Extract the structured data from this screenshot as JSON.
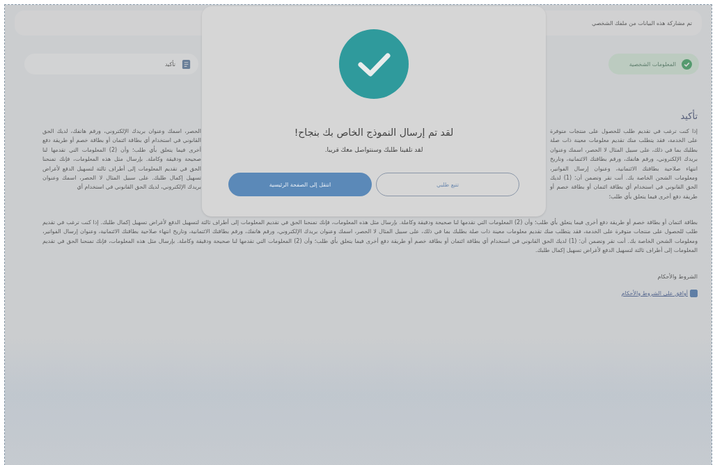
{
  "notice": {
    "text": "تم مشاركة هذه البيانات من ملفك الشخصي"
  },
  "steps": [
    {
      "label": "المعلومات الشخصية",
      "completed": true
    },
    {
      "label": "تأكيد",
      "completed": false
    }
  ],
  "section": {
    "title": "تأكيد",
    "paragraph_right": "إذا كنت ترغب في تقديم طلب للحصول على منتجات متوفرة على الخدمة، فقد يتطلب منك تقديم معلومات معينة ذات صلة بطلبك بما في ذلك، على سبيل المثال لا الحصر، اسمك وعنوان بريدك الإلكتروني، ورقم هاتفك، ورقم بطاقتك الائتمانية، وتاريخ انتهاء صلاحية بطاقتك الائتمانية، وعنوان إرسال الفواتير، ومعلومات الشحن الخاصة بك. أنت تقر وتضمن أن: (1) لديك الحق القانوني في استخدام أي بطاقة ائتمان أو بطاقة خصم أو طريقة دفع أخرى فيما يتعلق بأي طلب؛",
    "paragraph_left": "الحصر، اسمك وعنوان بريدك الإلكتروني، ورقم هاتفك، لديك الحق القانوني في استخدام أي بطاقة ائتمان أو بطاقة خصم أو طريقة دفع أخرى فيما يتعلق بأي طلب؛ وأن (2) المعلومات التي تقدمها لنا صحيحة ودقيقة وكاملة. بإرسال مثل هذه المعلومات، فإنك تمنحنا الحق في تقديم المعلومات إلى أطراف ثالثة لتسهيل الدفع لأغراض تسهيل إكمال طلبك. على سبيل المثال لا الحصر، اسمك وعنوان بريدك الإلكتروني، لديك الحق القانوني في استخدام أي",
    "paragraph_below": "بطاقة ائتمان أو بطاقة خصم أو طريقة دفع أخرى فيما يتعلق بأي طلب؛ وأن (2) المعلومات التي تقدمها لنا صحيحة ودقيقة وكاملة. بإرسال مثل هذه المعلومات، فإنك تمنحنا الحق في تقديم المعلومات إلى أطراف ثالثة لتسهيل الدفع لأغراض تسهيل إكمال طلبك. إذا كنت ترغب في تقديم طلب للحصول على منتجات متوفرة على الخدمة، فقد يتطلب منك تقديم معلومات معينة ذات صلة بطلبك بما في ذلك، على سبيل المثال لا الحصر، اسمك وعنوان بريدك الإلكتروني، ورقم هاتفك، ورقم بطاقتك الائتمانية، وتاريخ انتهاء صلاحية بطاقتك الائتمانية، وعنوان إرسال الفواتير، ومعلومات الشحن الخاصة بك. أنت تقر وتضمن أن: (1) لديك الحق القانوني في استخدام أي بطاقة ائتمان أو بطاقة خصم أو طريقة دفع أخرى فيما يتعلق بأي طلب؛ وأن (2) المعلومات التي تقدمها لنا صحيحة ودقيقة وكاملة. بإرسال مثل هذه المعلومات، فإنك تمنحنا الحق في تقديم المعلومات إلى أطراف ثالثة لتسهيل الدفع لأغراض تسهيل إكمال طلبك."
  },
  "terms": {
    "title": "الشروط والأحكام",
    "checkbox": {
      "label": "أوافق على الشروط والأحكام",
      "checked": true
    }
  },
  "dialog": {
    "title": "لقد تم إرسال النموذج الخاص بك بنجاح!",
    "message": "لقد تلقينا طلبك وسنتواصل معك قريبا.",
    "buttons": [
      {
        "label": "تتبع طلبي",
        "kind": "secondary"
      },
      {
        "label": "انتقل إلى الصفحة الرئيسية",
        "kind": "primary"
      }
    ]
  }
}
